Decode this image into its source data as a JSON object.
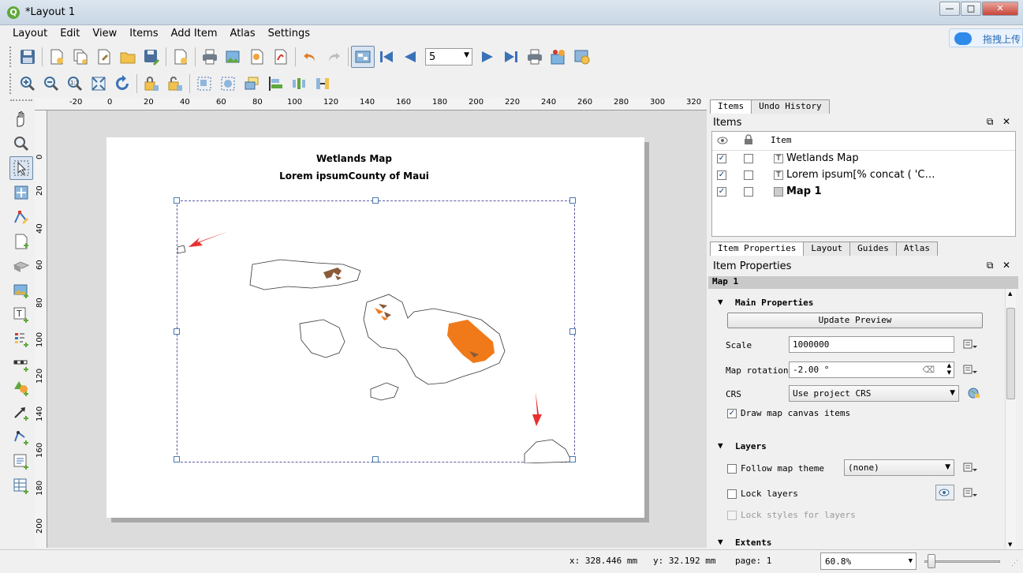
{
  "window": {
    "title": "*Layout 1",
    "app_icon": "Q",
    "minimize": "—",
    "maximize": "□",
    "close": "✕"
  },
  "cloud_badge": {
    "label": "拖拽上传"
  },
  "menu": [
    "Layout",
    "Edit",
    "View",
    "Items",
    "Add Item",
    "Atlas",
    "Settings"
  ],
  "atlas_toolbar": {
    "page_value": "5"
  },
  "hruler_labels": [
    "-20",
    "0",
    "20",
    "40",
    "60",
    "80",
    "100",
    "120",
    "140",
    "160",
    "180",
    "200",
    "220",
    "240",
    "260",
    "280",
    "300",
    "320"
  ],
  "vruler_labels": [
    "0",
    "20",
    "40",
    "60",
    "80",
    "100",
    "120",
    "140",
    "160",
    "180",
    "200"
  ],
  "layout_page": {
    "title": "Wetlands Map",
    "subtitle": "Lorem ipsumCounty of Maui"
  },
  "items_panel": {
    "tabs": [
      "Items",
      "Undo History"
    ],
    "title": "Items",
    "column_item": "Item",
    "rows": [
      {
        "name": "Wetlands Map",
        "visible": true,
        "locked": false,
        "type": "T"
      },
      {
        "name": "Lorem ipsum[% concat ( 'C…",
        "visible": true,
        "locked": false,
        "type": "T"
      },
      {
        "name": "Map 1",
        "visible": true,
        "locked": false,
        "type": ""
      }
    ]
  },
  "props_panel": {
    "tabs": [
      "Item Properties",
      "Layout",
      "Guides",
      "Atlas"
    ],
    "title": "Item Properties",
    "selected_item": "Map 1",
    "main_properties": {
      "header": "Main Properties",
      "update_preview": "Update Preview",
      "scale_label": "Scale",
      "scale_value": "1000000",
      "rotation_label": "Map rotation",
      "rotation_value": "-2.00 °",
      "crs_label": "CRS",
      "crs_value": "Use project CRS",
      "draw_canvas_items": "Draw map canvas items"
    },
    "layers": {
      "header": "Layers",
      "follow_theme": "Follow map theme",
      "theme_value": "(none)",
      "lock_layers": "Lock layers",
      "lock_styles": "Lock styles for layers"
    },
    "extents": {
      "header": "Extents"
    }
  },
  "status": {
    "x": "x: 328.446 mm",
    "y": "y: 32.192 mm",
    "page": "page: 1",
    "zoom": "60.8%"
  }
}
